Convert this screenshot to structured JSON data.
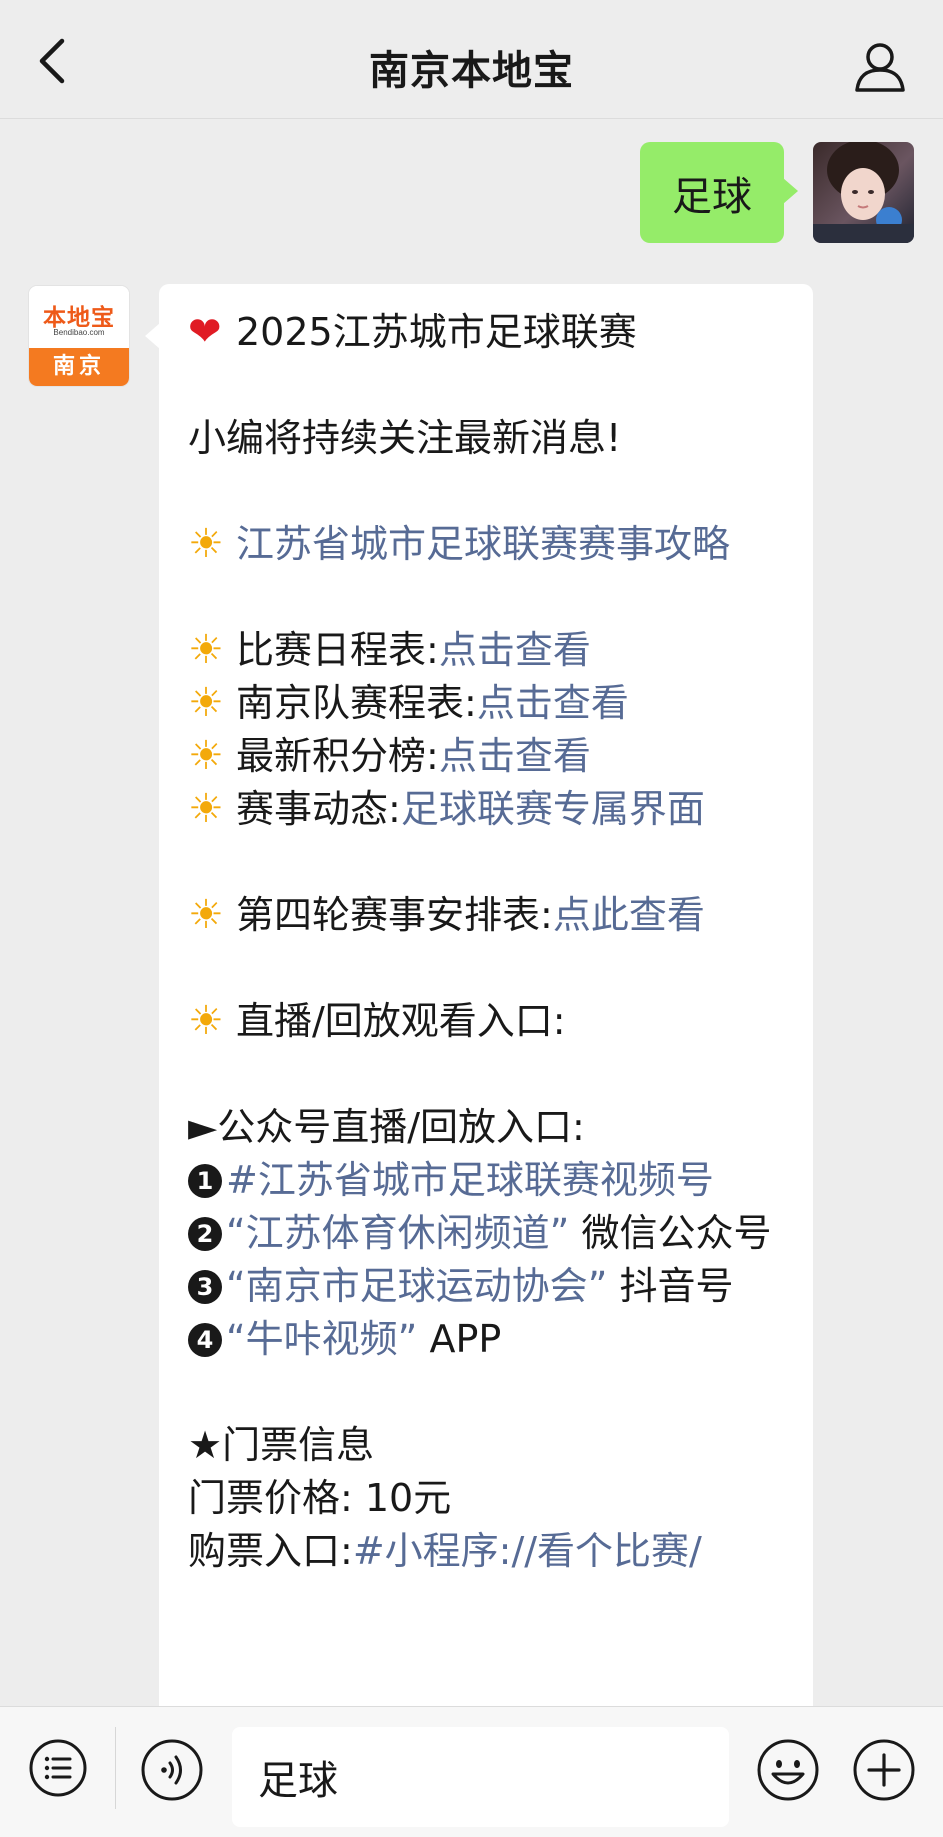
{
  "navbar": {
    "title": "南京本地宝"
  },
  "outgoing": {
    "text": "足球"
  },
  "bot_avatar": {
    "logo_main": "本地宝",
    "logo_sub": "Bendibao.com",
    "logo_city": "南京"
  },
  "message": {
    "title": "2025江苏城市足球联赛",
    "intro": "小编将持续关注最新消息!",
    "guide_link": "江苏省城市足球联赛赛事攻略",
    "items": [
      {
        "label": "比赛日程表:",
        "link": "点击查看"
      },
      {
        "label": "南京队赛程表:",
        "link": "点击查看"
      },
      {
        "label": "最新积分榜:",
        "link": "点击查看"
      },
      {
        "label": "赛事动态:",
        "link": "足球联赛专属界面"
      }
    ],
    "round4": {
      "label": "第四轮赛事安排表:",
      "link": "点此查看"
    },
    "live_header": "直播/回放观看入口:",
    "live_sub_header": "►公众号直播/回放入口:",
    "live_entries": [
      {
        "num": "1",
        "link": "#江苏省城市足球联赛视频号",
        "suffix": ""
      },
      {
        "num": "2",
        "link": "“江苏体育休闲频道”",
        "suffix": " 微信公众号"
      },
      {
        "num": "3",
        "link": "“南京市足球运动协会”",
        "suffix": " 抖音号"
      },
      {
        "num": "4",
        "link": "“牛咔视频”",
        "suffix": " APP"
      }
    ],
    "ticket_header": "★门票信息",
    "ticket_price": "门票价格: 10元",
    "ticket_buy_label": "购票入口:",
    "ticket_buy_link": "#小程序://看个比赛/"
  },
  "input": {
    "value": "足球"
  },
  "icons": {
    "back": "chevron-left-icon",
    "profile": "person-icon",
    "menu": "list-menu-icon",
    "voice": "voice-icon",
    "emoji": "smiley-icon",
    "plus": "plus-icon"
  },
  "colors": {
    "bubble_out": "#95ec69",
    "link": "#576b95",
    "background": "#ededed"
  }
}
